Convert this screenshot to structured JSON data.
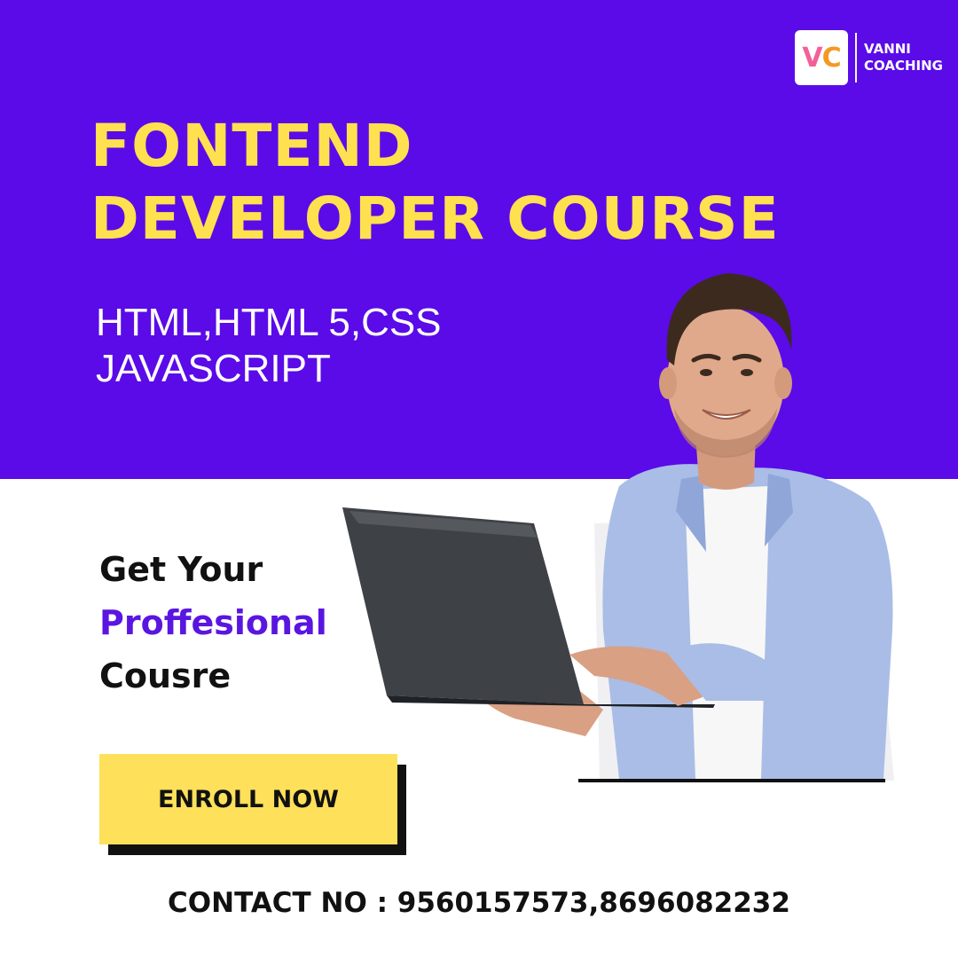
{
  "brand": {
    "badge_letters": {
      "v": "V",
      "c": "C"
    },
    "name_line1": "VANNI",
    "name_line2": "COACHING",
    "badge_colors": {
      "v": "#f2609a",
      "c": "#f39a24"
    }
  },
  "headline": {
    "line1": "FONTEND",
    "line2": "DEVELOPER COURSE"
  },
  "tech": {
    "line1": "HTML,HTML 5,CSS",
    "line2": "JAVASCRIPT"
  },
  "tagline": {
    "line1": "Get Your",
    "line2": "Proffesional",
    "line3": "Cousre"
  },
  "cta": {
    "label": "ENROLL NOW"
  },
  "contact": {
    "text": "CONTACT NO : 9560157573,8696082232"
  },
  "colors": {
    "primary": "#5a0be8",
    "headline": "#ffe14f",
    "button": "#ffe05b",
    "accent_text": "#5a16e0"
  },
  "illustration": {
    "icon": "person-with-laptop-icon"
  }
}
